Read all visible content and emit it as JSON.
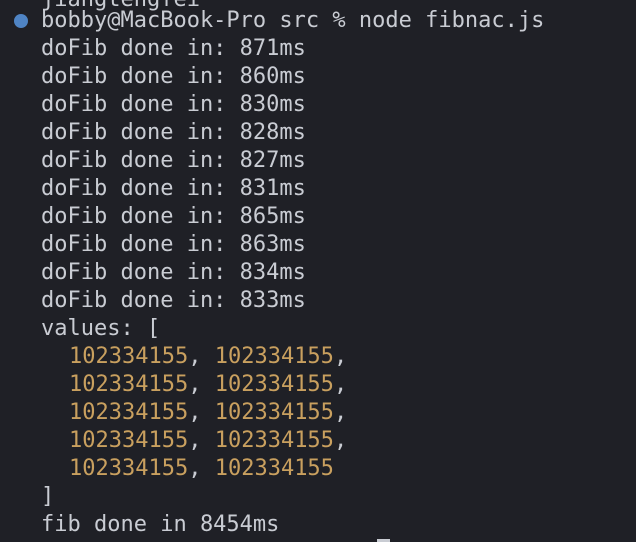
{
  "terminal": {
    "partial_top_line": "jiangtengfei",
    "prompt": "bobby@MacBook-Pro src % node fibnac.js",
    "prompt_indicator_color": "#4f84c4",
    "output_lines": [
      "doFib done in: 871ms",
      "doFib done in: 860ms",
      "doFib done in: 830ms",
      "doFib done in: 828ms",
      "doFib done in: 827ms",
      "doFib done in: 831ms",
      "doFib done in: 865ms",
      "doFib done in: 863ms",
      "doFib done in: 834ms",
      "doFib done in: 833ms"
    ],
    "values_open": "values: [",
    "values_rows": [
      {
        "a": "102334155",
        "sep": ", ",
        "b": "102334155",
        "end": ","
      },
      {
        "a": "102334155",
        "sep": ", ",
        "b": "102334155",
        "end": ","
      },
      {
        "a": "102334155",
        "sep": ", ",
        "b": "102334155",
        "end": ","
      },
      {
        "a": "102334155",
        "sep": ", ",
        "b": "102334155",
        "end": ","
      },
      {
        "a": "102334155",
        "sep": ", ",
        "b": "102334155",
        "end": ""
      }
    ],
    "values_close": "]",
    "final_line": "fib done in 8454ms",
    "number_color": "#c9a05f"
  }
}
